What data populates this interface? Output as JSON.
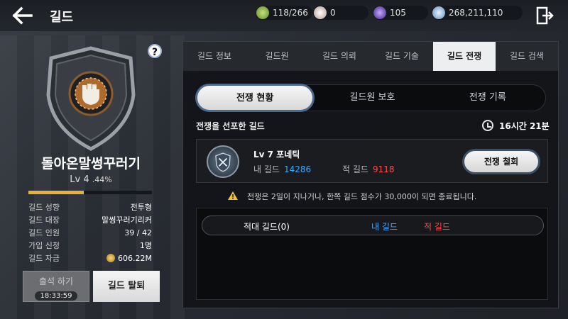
{
  "header": {
    "title": "길드",
    "resources": [
      {
        "value": "118/266",
        "icon": "energy-icon",
        "color": "#8fc24a"
      },
      {
        "value": "0",
        "icon": "pearl-icon",
        "color": "#d8c0b8"
      },
      {
        "value": "105",
        "icon": "purple-gem-icon",
        "color": "#7b5bd6"
      },
      {
        "value": "268,211,110",
        "icon": "silver-coin-icon",
        "color": "#9ec6e8"
      }
    ]
  },
  "guild": {
    "name": "돌아온말썽꾸러기",
    "level": "Lv 4",
    "level_pct": ".44%",
    "xp_fraction": 0.45,
    "info": [
      {
        "key": "길드 성향",
        "value": "전투형"
      },
      {
        "key": "길드 대장",
        "value": "말썽꾸러기리커"
      },
      {
        "key": "길드 인원",
        "value": "39 / 42"
      },
      {
        "key": "가입 신청",
        "value": "1명"
      },
      {
        "key": "길드 자금",
        "value": "606.22M"
      }
    ],
    "attend_label": "출석 하기",
    "attend_timer": "18:33:59",
    "leave_label": "길드 탈퇴"
  },
  "tabs": [
    {
      "label": "길드 정보",
      "active": false
    },
    {
      "label": "길드원",
      "active": false
    },
    {
      "label": "길드 의뢰",
      "active": false
    },
    {
      "label": "길드 기술",
      "active": false
    },
    {
      "label": "길드 전쟁",
      "active": true
    },
    {
      "label": "길드 검색",
      "active": false
    }
  ],
  "subtabs": [
    {
      "label": "전쟁 현황",
      "active": true
    },
    {
      "label": "길드원 보호",
      "active": false
    },
    {
      "label": "전쟁 기록",
      "active": false
    }
  ],
  "war": {
    "section_title": "전쟁을 선포한 길드",
    "time_left": "16시간 21분",
    "enemy": {
      "level_name": "Lv 7 포네틱",
      "my_label": "내 길드",
      "my_score": "14286",
      "enemy_label": "적 길드",
      "enemy_score": "9118"
    },
    "cancel_label": "전쟁 철회",
    "notice": "전쟁은 2일이 지나거나, 한쪽 길드 점수가 30,000이 되면 종료됩니다.",
    "table_headers": {
      "hostile": "적대 길드(0)",
      "mine": "내 길드",
      "enemy": "적 길드"
    }
  }
}
